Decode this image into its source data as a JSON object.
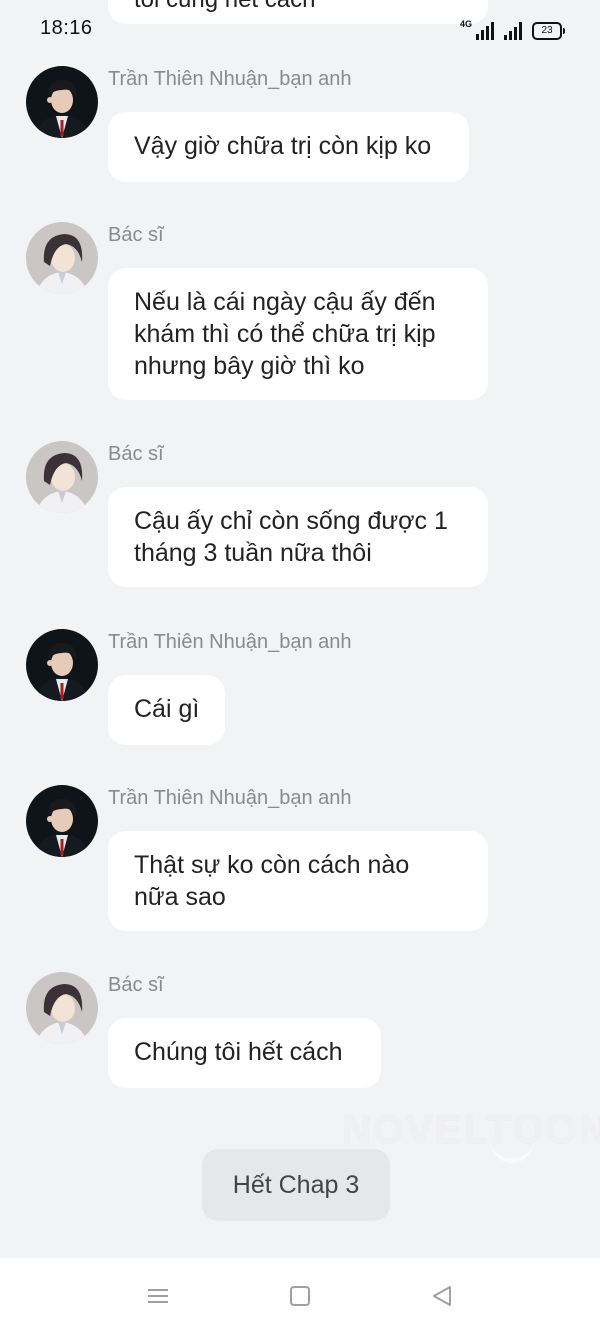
{
  "status_bar": {
    "time": "18:16",
    "network": "4G",
    "battery": "23"
  },
  "top_partial_message": "tôi cũng hết cách",
  "messages": [
    {
      "sender": "Trần Thiên Nhuận_bạn anh",
      "lines": [
        "Vậy giờ chữa trị còn kịp ko"
      ],
      "avatar": "boy-avatar"
    },
    {
      "sender": "Bác sĩ",
      "lines": [
        "Nếu là cái ngày cậu ấy đến",
        "khám thì có thể chữa trị kịp",
        "nhưng bây giờ thì ko"
      ],
      "avatar": "doctor-avatar"
    },
    {
      "sender": "Bác sĩ",
      "lines": [
        "Cậu ấy chỉ còn sống được 1",
        "tháng 3 tuần nữa thôi"
      ],
      "avatar": "doctor-avatar"
    },
    {
      "sender": "Trần Thiên Nhuận_bạn anh",
      "lines": [
        "Cái gì"
      ],
      "avatar": "boy-avatar"
    },
    {
      "sender": "Trần Thiên Nhuận_bạn anh",
      "lines": [
        "Thật sự ko còn cách nào",
        "nữa sao"
      ],
      "avatar": "boy-avatar"
    },
    {
      "sender": "Bác sĩ",
      "lines": [
        "Chúng tôi hết cách"
      ],
      "avatar": "doctor-avatar"
    }
  ],
  "watermark": "NOVELTOON",
  "end_label": "Hết Chap 3",
  "nav": {
    "icons": [
      "menu-icon",
      "home-square-icon",
      "back-triangle-icon"
    ]
  },
  "colors": {
    "background": "#f2f3f5",
    "bubble": "#ffffff",
    "sender_text": "#8a8a8a",
    "end_chip": "#e6e7e9"
  }
}
